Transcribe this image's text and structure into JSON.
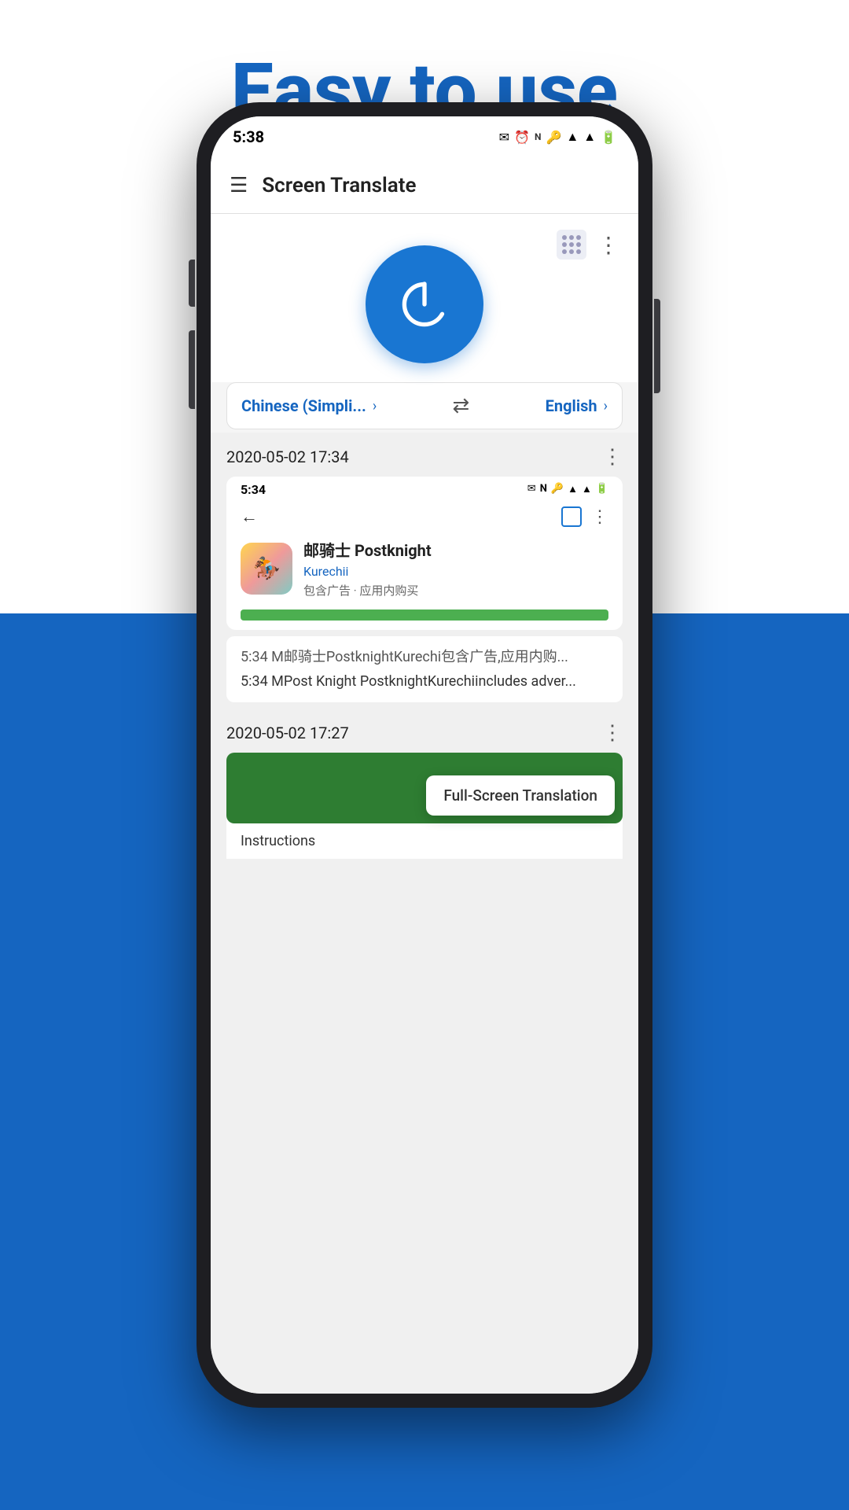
{
  "hero": {
    "title": "Easy to use"
  },
  "status_bar": {
    "time": "5:38",
    "icons": "⏰ 🔕 🔑 ▲ ▲ 🔋"
  },
  "app_bar": {
    "title": "Screen Translate"
  },
  "language_selector": {
    "source_lang": "Chinese (Simpli...",
    "target_lang": "English",
    "swap_label": "⇄"
  },
  "history": [
    {
      "timestamp": "2020-05-02 17:34",
      "mini_status_time": "5:34",
      "app_name": "邮骑士 Postknight",
      "app_developer": "Kurechii",
      "app_meta": "包含广告 · 应用内购买",
      "original_text": "5:34 M邮骑士PostknightKurechi包含广告,应用内购...",
      "translated_text": "5:34 MPost Knight PostknightKurechiincludes adver..."
    },
    {
      "timestamp": "2020-05-02 17:27",
      "tooltip": "Full-Screen Translation",
      "sub_label": "Instructions"
    }
  ]
}
